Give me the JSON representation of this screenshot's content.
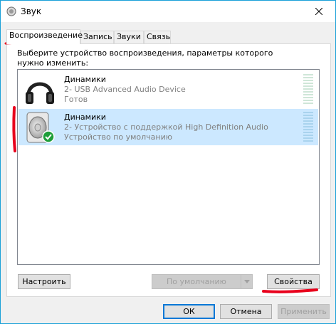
{
  "window": {
    "title": "Звук"
  },
  "tabs": [
    {
      "label": "Воспроизведение"
    },
    {
      "label": "Запись"
    },
    {
      "label": "Звуки"
    },
    {
      "label": "Связь"
    }
  ],
  "instruction": "Выберите устройство воспроизведения, параметры которого нужно изменить:",
  "devices": [
    {
      "name": "Динамики",
      "description": "2- USB Advanced Audio Device",
      "status": "Готов",
      "icon": "headphones-icon"
    },
    {
      "name": "Динамики",
      "description": "2- Устройство с поддержкой High Definition Audio",
      "status": "Устройство по умолчанию",
      "icon": "speaker-icon"
    }
  ],
  "buttons": {
    "configure": "Настроить",
    "default": "По умолчанию",
    "properties": "Свойства",
    "ok": "ОК",
    "cancel": "Отмена",
    "apply": "Применить"
  },
  "colors": {
    "accent": "#0078d7",
    "selection": "#cce8ff",
    "annotation": "#e8001c",
    "default_badge": "#1e9e3a"
  }
}
